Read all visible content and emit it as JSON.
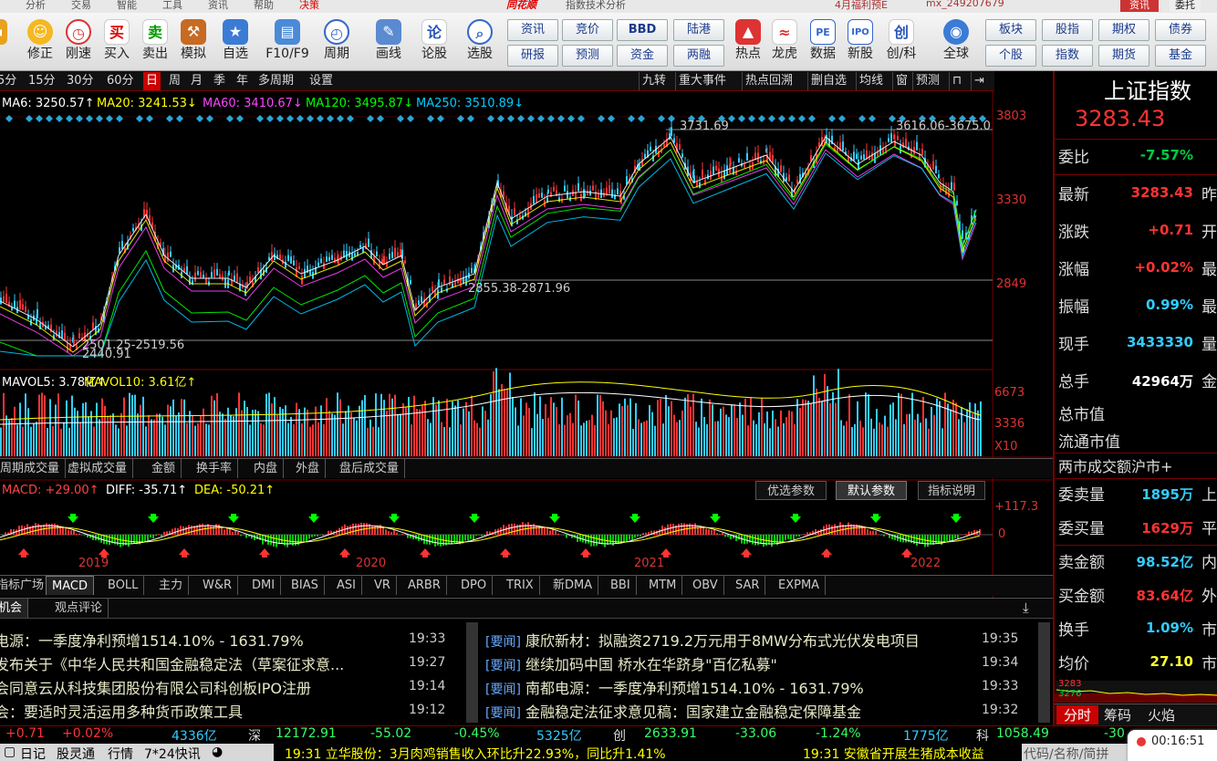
{
  "top_menu": {
    "items": [
      "分析",
      "交易",
      "智能",
      "工具",
      "资讯",
      "帮助",
      "决策"
    ],
    "center": "指数技术分析",
    "brand": "同花顺",
    "promo": "4月福利预E",
    "user": "mx_249207679",
    "right_buttons": [
      "资讯",
      "委托"
    ]
  },
  "toolbar": {
    "buttons": [
      {
        "label": "修正",
        "icon": "smile-icon"
      },
      {
        "label": "刚速",
        "icon": "clock-icon"
      },
      {
        "label": "买入",
        "icon": "buy-icon",
        "glyph": "买"
      },
      {
        "label": "卖出",
        "icon": "sell-icon",
        "glyph": "卖"
      },
      {
        "label": "模拟",
        "icon": "hammer-icon"
      },
      {
        "label": "自选",
        "icon": "star-icon"
      },
      {
        "label": "F10/F9",
        "icon": "f10-icon"
      },
      {
        "label": "周期",
        "icon": "cycle-icon"
      },
      {
        "label": "画线",
        "icon": "pen-icon"
      },
      {
        "label": "论股",
        "icon": "discuss-icon",
        "glyph": "论"
      },
      {
        "label": "选股",
        "icon": "select-icon"
      }
    ],
    "text_buttons_left": [
      [
        "资讯",
        "研报"
      ],
      [
        "竞价",
        "预测"
      ],
      [
        "BBD",
        "资金"
      ],
      [
        "陆港",
        "两融"
      ]
    ],
    "icon_buttons_right": [
      {
        "label": "热点",
        "icon": "hot-icon"
      },
      {
        "label": "龙虎",
        "icon": "dragon-icon"
      },
      {
        "label": "数据",
        "icon": "pe-icon",
        "glyph": "PE"
      },
      {
        "label": "新股",
        "icon": "ipo-icon",
        "glyph": "IPO"
      },
      {
        "label": "创/科",
        "icon": "chuang-icon",
        "glyph": "创"
      },
      {
        "label": "全球",
        "icon": "globe-icon"
      }
    ],
    "text_buttons_right": [
      [
        "板块",
        "个股"
      ],
      [
        "股指",
        "指数"
      ],
      [
        "期权",
        "期货"
      ],
      [
        "债券",
        "基金"
      ]
    ]
  },
  "period_bar": {
    "periods": [
      "5分",
      "15分",
      "30分",
      "60分",
      "日",
      "周",
      "月",
      "季",
      "年",
      "多周期",
      "设置"
    ],
    "active": "日",
    "right_items": [
      "九转",
      "重大事件",
      "热点回溯",
      "删自选",
      "均线",
      "窗",
      "预测"
    ]
  },
  "ma_legend": [
    {
      "text": "MA6: 3250.57↑",
      "color": "#ffffff"
    },
    {
      "text": "MA20: 3241.53↓",
      "color": "#ffff00"
    },
    {
      "text": "MA60: 3410.67↓",
      "color": "#ff44ff"
    },
    {
      "text": "MA120: 3495.87↓",
      "color": "#00ff00"
    },
    {
      "text": "MA250: 3510.89↓",
      "color": "#00ccff"
    }
  ],
  "price_axis": [
    "3803",
    "3330",
    "2849"
  ],
  "annotations": {
    "high": "3731.69",
    "right_high": "3616.06-3675.0",
    "mid": "2855.38-2871.96",
    "low_range": "2501.25-2519.56",
    "low": "2440.91"
  },
  "volume": {
    "legend": [
      {
        "text": "MAVOL5: 3.78亿↑",
        "color": "#ffffff"
      },
      {
        "text": "MAVOL10: 3.61亿↑",
        "color": "#ffff00"
      }
    ],
    "axis": [
      "6673",
      "3336",
      "X10"
    ]
  },
  "sub_tabs": [
    "周期成交量",
    "虚拟成交量",
    "金额",
    "换手率",
    "内盘",
    "外盘",
    "盘后成交量"
  ],
  "macd": {
    "legend": [
      {
        "text": "MACD: +29.00↑",
        "color": "#ff4444"
      },
      {
        "text": "DIFF: -35.71↑",
        "color": "#ffffff"
      },
      {
        "text": "DEA: -50.21↑",
        "color": "#ffff00"
      }
    ],
    "buttons": [
      "优选参数",
      "默认参数",
      "指标说明"
    ],
    "active_button": "默认参数",
    "axis": [
      "+117.3",
      "0"
    ],
    "years": [
      "2019",
      "2020",
      "2021",
      "2022"
    ]
  },
  "indicator_tabs": [
    "指标广场",
    "MACD",
    "BOLL",
    "主力",
    "W&R",
    "DMI",
    "BIAS",
    "ASI",
    "VR",
    "ARBR",
    "DPO",
    "TRIX",
    "新DMA",
    "BBI",
    "MTM",
    "OBV",
    "SAR",
    "EXPMA"
  ],
  "active_indicator": "MACD",
  "news_tabs": [
    "机会",
    "观点评论"
  ],
  "news_left": [
    {
      "text": "电源：一季度净利预增1514.10% - 1631.79%",
      "time": "19:33"
    },
    {
      "text": "发布关于《中华人民共和国金融稳定法（草案征求意...",
      "time": "19:27"
    },
    {
      "text": "会同意云从科技集团股份有限公司科创板IPO注册",
      "time": "19:14"
    },
    {
      "text": "会：要适时灵活运用多种货币政策工具",
      "time": "19:12"
    }
  ],
  "news_right": [
    {
      "tag": "[要闻]",
      "text": "康欣新材：拟融资2719.2万元用于8MW分布式光伏发电项目",
      "time": "19:35"
    },
    {
      "tag": "[要闻]",
      "text": "继续加码中国 桥水在华跻身\"百亿私募\"",
      "time": "19:34"
    },
    {
      "tag": "[要闻]",
      "text": "南都电源：一季度净利预增1514.10% - 1631.79%",
      "time": "19:33"
    },
    {
      "tag": "[要闻]",
      "text": "金融稳定法征求意见稿：国家建立金融稳定保障基金",
      "time": "19:32"
    }
  ],
  "right_panel": {
    "title": "上证指数",
    "price": "3283.43",
    "rows": [
      {
        "label": "委比",
        "value": "-7.57%",
        "color": "green",
        "extra": ""
      },
      {
        "label": "最新",
        "value": "3283.43",
        "color": "red",
        "extra": "昨"
      },
      {
        "label": "涨跌",
        "value": "+0.71",
        "color": "red",
        "extra": "开"
      },
      {
        "label": "涨幅",
        "value": "+0.02%",
        "color": "red",
        "extra": "最"
      },
      {
        "label": "振幅",
        "value": "0.99%",
        "color": "cyan",
        "extra": "最"
      },
      {
        "label": "现手",
        "value": "3433330",
        "color": "cyan",
        "extra": "量"
      },
      {
        "label": "总手",
        "value": "42964万",
        "color": "white",
        "extra": "金"
      }
    ],
    "plain_rows": [
      "总市值",
      "流通市值",
      "两市成交额沪市+"
    ],
    "rows2": [
      {
        "label": "委卖量",
        "value": "1895万",
        "color": "cyan",
        "extra": "上"
      },
      {
        "label": "委买量",
        "value": "1629万",
        "color": "red",
        "extra": "平"
      },
      {
        "label": "卖金额",
        "value": "98.52亿",
        "color": "cyan",
        "extra": "内"
      },
      {
        "label": "买金额",
        "value": "83.64亿",
        "color": "red",
        "extra": "外"
      },
      {
        "label": "换手",
        "value": "1.09%",
        "color": "cyan",
        "extra": "市"
      },
      {
        "label": "均价",
        "value": "27.10",
        "color": "yellow",
        "extra": "市"
      }
    ],
    "mini_values": [
      "3283",
      "3276"
    ],
    "bottom_tabs": [
      "分时",
      "筹码",
      "火焰"
    ]
  },
  "status_bar": {
    "items": [
      {
        "text": "+0.71",
        "color": "#ff3333"
      },
      {
        "text": "+0.02%",
        "color": "#ff3333"
      },
      {
        "text": "4336亿",
        "color": "#33ccff"
      },
      {
        "text": "深",
        "color": "#dddddd"
      },
      {
        "text": "12172.91",
        "color": "#33ff66"
      },
      {
        "text": "-55.02",
        "color": "#33ff66"
      },
      {
        "text": "-0.45%",
        "color": "#33ff66"
      },
      {
        "text": "5325亿",
        "color": "#33ccff"
      },
      {
        "text": "创",
        "color": "#dddddd"
      },
      {
        "text": "2633.91",
        "color": "#33ff66"
      },
      {
        "text": "-33.06",
        "color": "#33ff66"
      },
      {
        "text": "-1.24%",
        "color": "#33ff66"
      },
      {
        "text": "1775亿",
        "color": "#33ccff"
      },
      {
        "text": "科",
        "color": "#dddddd"
      },
      {
        "text": "1058.49",
        "color": "#33ff66"
      },
      {
        "text": "-30",
        "color": "#33ff66"
      }
    ]
  },
  "bottom_bar": {
    "items": [
      "日记",
      "股灵通",
      "行情",
      "7*24快讯"
    ],
    "ticker1": "19:31 立华股份：3月肉鸡销售收入环比升22.93%，同比升1.41%",
    "ticker2": "19:31 安徽省开展生猪成本收益",
    "search": "代码/名称/简拼"
  },
  "clock": "00:16:51"
}
